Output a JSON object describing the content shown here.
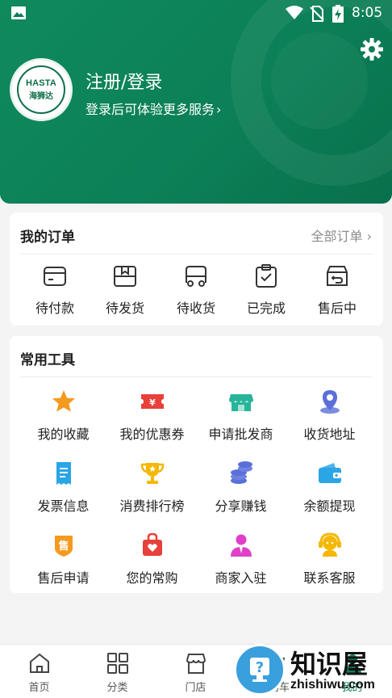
{
  "status": {
    "time": "8:05"
  },
  "header": {
    "logo": {
      "en": "HASTA",
      "cn": "海狮达"
    },
    "login_title": "注册/登录",
    "login_subtitle": "登录后可体验更多服务"
  },
  "orders": {
    "title": "我的订单",
    "all_label": "全部订单",
    "items": [
      {
        "label": "待付款",
        "icon": "card-icon"
      },
      {
        "label": "待发货",
        "icon": "box-icon"
      },
      {
        "label": "待收货",
        "icon": "truck-icon"
      },
      {
        "label": "已完成",
        "icon": "clipboard-check-icon"
      },
      {
        "label": "售后中",
        "icon": "return-box-icon"
      }
    ]
  },
  "tools": {
    "title": "常用工具",
    "items": [
      {
        "label": "我的收藏",
        "icon": "star-icon"
      },
      {
        "label": "我的优惠券",
        "icon": "coupon-icon"
      },
      {
        "label": "申请批发商",
        "icon": "store-icon"
      },
      {
        "label": "收货地址",
        "icon": "location-icon"
      },
      {
        "label": "发票信息",
        "icon": "invoice-icon"
      },
      {
        "label": "消费排行榜",
        "icon": "trophy-icon"
      },
      {
        "label": "分享赚钱",
        "icon": "coins-icon"
      },
      {
        "label": "余额提现",
        "icon": "wallet-icon"
      },
      {
        "label": "售后申请",
        "icon": "after-sale-icon"
      },
      {
        "label": "您的常购",
        "icon": "bag-heart-icon"
      },
      {
        "label": "商家入驻",
        "icon": "merchant-icon"
      },
      {
        "label": "联系客服",
        "icon": "customer-service-icon"
      }
    ]
  },
  "nav": {
    "items": [
      {
        "label": "首页",
        "icon": "home-icon"
      },
      {
        "label": "分类",
        "icon": "grid-icon"
      },
      {
        "label": "门店",
        "icon": "shop-icon"
      },
      {
        "label": "购物车",
        "icon": "cart-icon"
      },
      {
        "label": "我的",
        "icon": "user-icon"
      }
    ]
  },
  "watermark": {
    "text": "知识屋",
    "url": "zhishiwu.com"
  },
  "colors": {
    "brand": "#0c7f57",
    "accent_orange": "#f39a1f",
    "accent_red": "#e8403a"
  }
}
